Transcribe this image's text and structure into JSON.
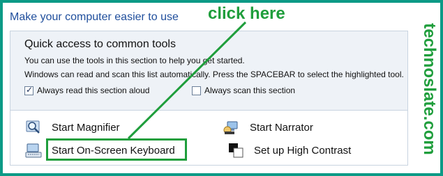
{
  "page": {
    "title": "Make your computer easier to use"
  },
  "quick_access": {
    "heading": "Quick access to common tools",
    "line1": "You can use the tools in this section to help you get started.",
    "line2": "Windows can read and scan this list automatically.  Press the SPACEBAR to select the highlighted tool.",
    "checkboxes": [
      {
        "label": "Always read this section aloud",
        "checked": true
      },
      {
        "label": "Always scan this section",
        "checked": false
      }
    ]
  },
  "tools": {
    "magnifier": "Start Magnifier",
    "narrator": "Start Narrator",
    "keyboard": "Start On-Screen Keyboard",
    "high_contrast": "Set up High Contrast"
  },
  "annotation": {
    "text": "click here",
    "color": "#1f9e3c"
  },
  "watermark": {
    "text": "technoslate.com",
    "color": "#1f9e3c"
  },
  "colors": {
    "frame": "#0c9a86",
    "title": "#1f4e9c",
    "panel_bg": "#eef2f7"
  }
}
